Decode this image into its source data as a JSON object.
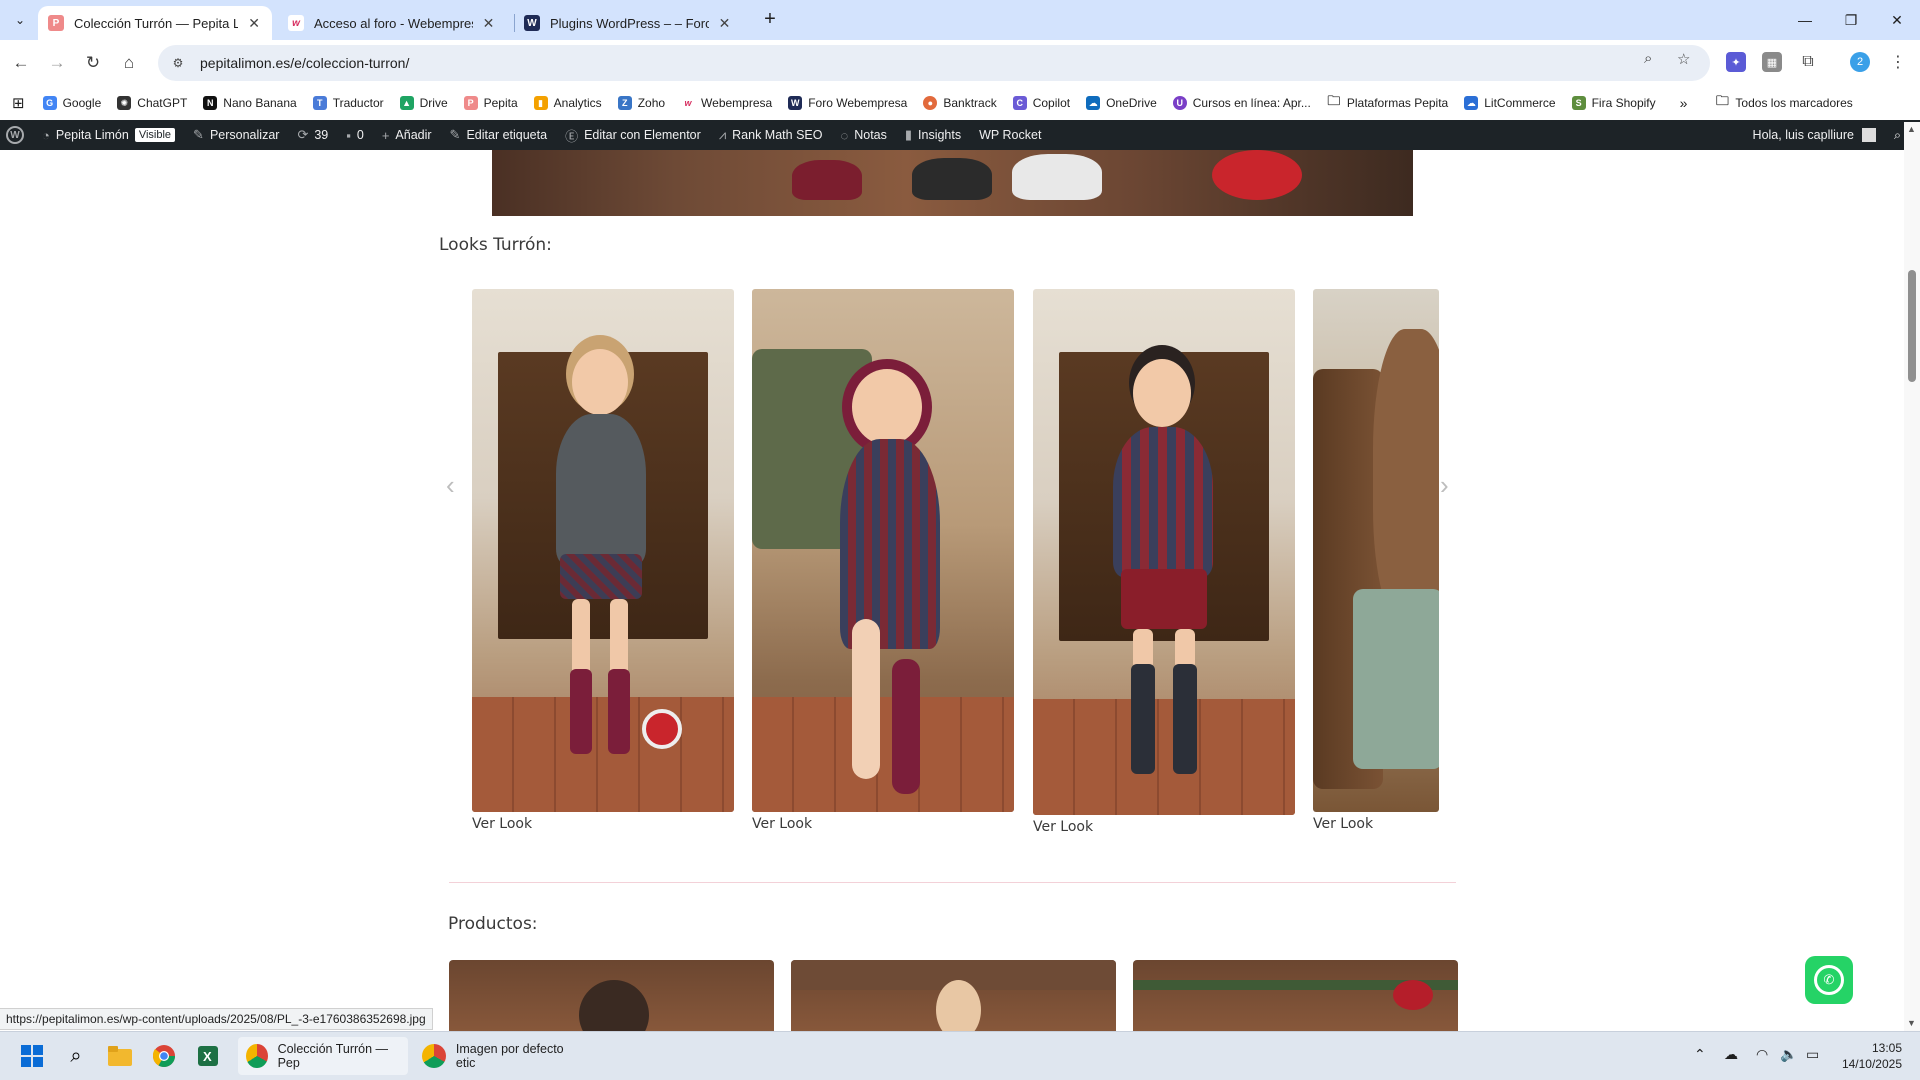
{
  "browser": {
    "tabs": [
      {
        "title": "Colección Turrón — Pepita Limón",
        "favicon_color": "#ef8a8a",
        "active": true
      },
      {
        "title": "Acceso al foro - Webempresa Eu",
        "favicon_color": "#d62d5f",
        "active": false
      },
      {
        "title": "Plugins WordPress – – Foro Web",
        "favicon_color": "#1f2b56",
        "active": false
      }
    ],
    "url": "pepitalimon.es/e/coleccion-turron/"
  },
  "bookmarks": [
    {
      "label": "Google",
      "color": "#4285f4"
    },
    {
      "label": "ChatGPT",
      "color": "#333333"
    },
    {
      "label": "Nano Banana",
      "color": "#111111"
    },
    {
      "label": "Traductor",
      "color": "#4a7bd8"
    },
    {
      "label": "Drive",
      "color": "#1fa463"
    },
    {
      "label": "Pepita",
      "color": "#ef8a8a"
    },
    {
      "label": "Analytics",
      "color": "#f4a100"
    },
    {
      "label": "Zoho",
      "color": "#3975c6"
    },
    {
      "label": "Webempresa",
      "color": "#d62d5f"
    },
    {
      "label": "Foro Webempresa",
      "color": "#1f2b56"
    },
    {
      "label": "Banktrack",
      "color": "#e26a3c"
    },
    {
      "label": "Copilot",
      "color": "#6b5bd6"
    },
    {
      "label": "OneDrive",
      "color": "#0f6cbd"
    },
    {
      "label": "Cursos en línea: Apr...",
      "color": "#7a3fc7"
    },
    {
      "label": "Plataformas Pepita",
      "color": "#555555"
    },
    {
      "label": "LitCommerce",
      "color": "#2b6fd6"
    },
    {
      "label": "Fira Shopify",
      "color": "#5e8e3e"
    }
  ],
  "bookmarks_all": "Todos los marcadores",
  "wpbar": {
    "site": "Pepita Limón",
    "visible": "Visible",
    "customize": "Personalizar",
    "updates": "39",
    "comments": "0",
    "add": "Añadir",
    "edit_tag": "Editar etiqueta",
    "elementor": "Editar con Elementor",
    "rankmath": "Rank Math SEO",
    "notes": "Notas",
    "insights": "Insights",
    "wprocket": "WP Rocket",
    "greeting": "Hola, luis caplliure"
  },
  "content": {
    "looks_title": "Looks Turrón:",
    "looks": [
      {
        "caption": "Ver Look"
      },
      {
        "caption": "Ver Look"
      },
      {
        "caption": "Ver Look"
      },
      {
        "caption": "Ver Look"
      }
    ],
    "products_title": "Productos:"
  },
  "status_url": "https://pepitalimon.es/wp-content/uploads/2025/08/PL_-3-e1760386352698.jpg",
  "taskbar": {
    "apps": [
      {
        "label": "Colección Turrón — Pep"
      },
      {
        "label": "Imagen por defecto etic"
      }
    ],
    "time": "13:05",
    "date": "14/10/2025"
  }
}
